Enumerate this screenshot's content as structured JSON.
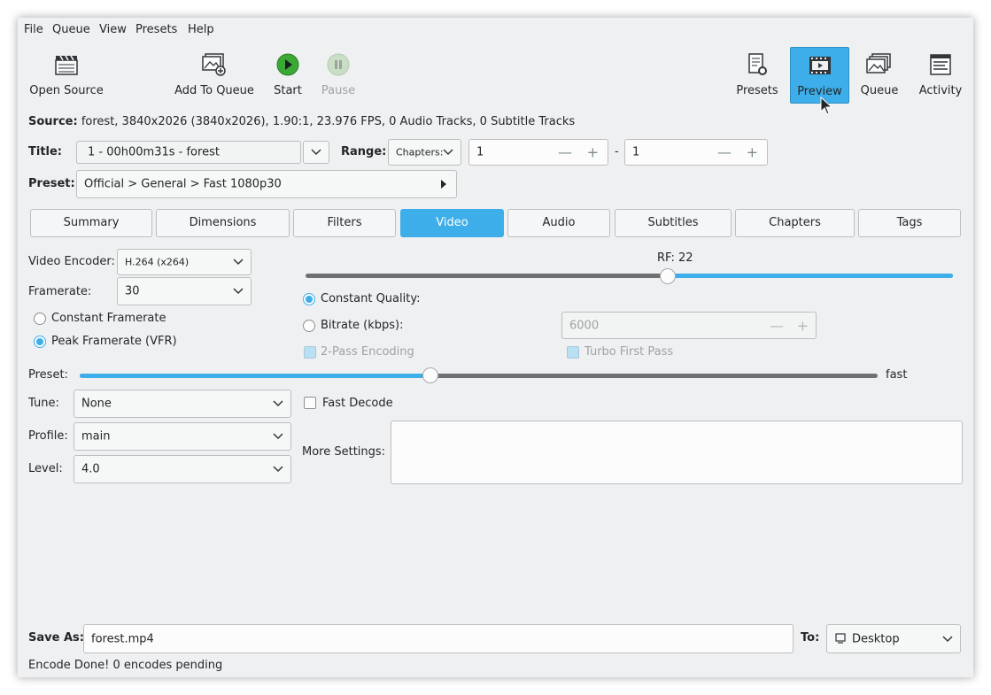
{
  "menu": [
    "File",
    "Queue",
    "View",
    "Presets",
    "Help"
  ],
  "toolbar": {
    "open_source": "Open Source",
    "add_to_queue": "Add To Queue",
    "start": "Start",
    "pause": "Pause",
    "presets": "Presets",
    "preview": "Preview",
    "queue": "Queue",
    "activity": "Activity"
  },
  "source": {
    "label": "Source:",
    "value": "forest, 3840x2026 (3840x2026), 1.90:1, 23.976 FPS, 0 Audio Tracks, 0 Subtitle Tracks"
  },
  "title": {
    "label": "Title:",
    "value": "1 - 00h00m31s - forest"
  },
  "range": {
    "label": "Range:",
    "mode": "Chapters:",
    "start": "1",
    "separator": "-",
    "end": "1",
    "minus": "—",
    "plus": "+"
  },
  "preset": {
    "label": "Preset:",
    "value": "Official > General > Fast 1080p30"
  },
  "tabs": [
    "Summary",
    "Dimensions",
    "Filters",
    "Video",
    "Audio",
    "Subtitles",
    "Chapters",
    "Tags"
  ],
  "active_tab": "Video",
  "video": {
    "encoder_label": "Video Encoder:",
    "encoder_value": "H.264 (x264)",
    "framerate_label": "Framerate:",
    "framerate_value": "30",
    "constant_framerate": "Constant Framerate",
    "peak_framerate": "Peak Framerate (VFR)",
    "rf_label": "RF: 22",
    "rf_value": 22,
    "rf_fraction": 0.56,
    "constant_quality": "Constant Quality:",
    "bitrate_label": "Bitrate (kbps):",
    "bitrate_value": "6000",
    "two_pass": "2-Pass Encoding",
    "turbo_first_pass": "Turbo First Pass",
    "preset_label": "Preset:",
    "preset_speed": "fast",
    "preset_fraction": 0.44,
    "tune_label": "Tune:",
    "tune_value": "None",
    "fast_decode": "Fast Decode",
    "profile_label": "Profile:",
    "profile_value": "main",
    "level_label": "Level:",
    "level_value": "4.0",
    "more_settings_label": "More Settings:",
    "more_settings_value": ""
  },
  "save": {
    "label": "Save As:",
    "value": "forest.mp4",
    "to_label": "To:",
    "to_value": "Desktop"
  },
  "status": "Encode Done! 0 encodes pending",
  "colors": {
    "accent": "#3daee9",
    "window": "#eff0f1",
    "start_green": "#3aaa35"
  }
}
